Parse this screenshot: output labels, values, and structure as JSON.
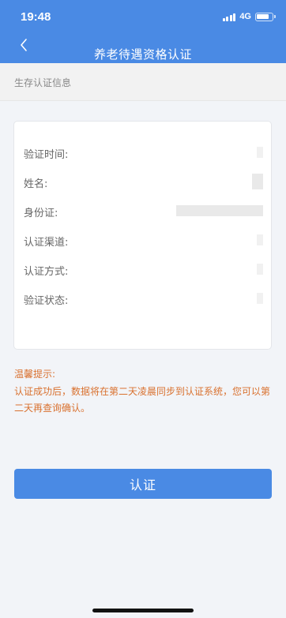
{
  "status_bar": {
    "time": "19:48",
    "network": "4G"
  },
  "nav": {
    "back_icon": "chevron-left-icon",
    "title": "养老待遇资格认证"
  },
  "section": {
    "label": "生存认证信息"
  },
  "info_rows": [
    {
      "label": "验证时间:",
      "value": ""
    },
    {
      "label": "姓名:",
      "value": ""
    },
    {
      "label": "身份证:",
      "value": ""
    },
    {
      "label": "认证渠道:",
      "value": ""
    },
    {
      "label": "认证方式:",
      "value": ""
    },
    {
      "label": "验证状态:",
      "value": ""
    }
  ],
  "tips": {
    "title": "温馨提示:",
    "body": "认证成功后，数据将在第二天凌晨同步到认证系统，您可以第二天再查询确认。"
  },
  "confirm_button": {
    "label": "认证"
  },
  "colors": {
    "primary": "#4a8ae4",
    "tip_text": "#d9712f",
    "page_bg": "#f2f4f8"
  }
}
